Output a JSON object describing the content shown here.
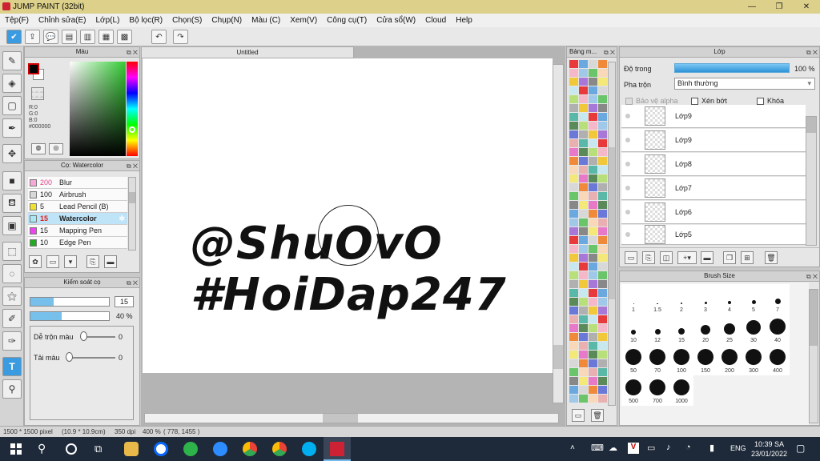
{
  "window": {
    "title": "JUMP PAINT (32bit)"
  },
  "menu": [
    "Tệp(F)",
    "Chỉnh sửa(E)",
    "Lớp(L)",
    "Bộ lọc(R)",
    "Chọn(S)",
    "Chụp(N)",
    "Màu (C)",
    "Xem(V)",
    "Công cụ(T)",
    "Cửa sổ(W)",
    "Cloud",
    "Help"
  ],
  "color_panel": {
    "title": "Màu",
    "r": "R:0",
    "g": "G:0",
    "b": "B:0",
    "hex": "#000000"
  },
  "brush_panel": {
    "title": "Cọ: Watercolor",
    "items": [
      {
        "size": "200",
        "name": "Blur",
        "color": "#f7a8d8",
        "size_color": "#e0458a"
      },
      {
        "size": "100",
        "name": "Airbrush",
        "color": "#d8d8d8",
        "size_color": "#222"
      },
      {
        "size": "5",
        "name": "Lead Pencil (B)",
        "color": "#f0e030",
        "size_color": "#222"
      },
      {
        "size": "15",
        "name": "Watercolor",
        "color": "#a8e8f0",
        "size_color": "#e02020"
      },
      {
        "size": "15",
        "name": "Mapping Pen",
        "color": "#ee44ee",
        "size_color": "#222"
      },
      {
        "size": "10",
        "name": "Edge Pen",
        "color": "#22aa22",
        "size_color": "#222"
      }
    ]
  },
  "control_panel": {
    "title": "Kiểm soát cọ",
    "size_value": "15",
    "opacity_value": "40 %",
    "opacity": 0.4,
    "blend_label": "Dễ trộn màu",
    "blend_value": "0",
    "redraw_label": "Tải màu",
    "redraw_value": "0"
  },
  "canvas": {
    "tab_title": "Untitled",
    "text_line1": "@ShuOvO",
    "text_line2": "#HoiDap247"
  },
  "palette_panel": {
    "title": "Bảng m..."
  },
  "layer_panel": {
    "title": "Lớp",
    "opacity_label": "Độ trong",
    "opacity_value": "100 %",
    "opacity": 1.0,
    "blend_label": "Pha trộn",
    "blend_value": "Bình thường",
    "protect_alpha": "Bảo vệ alpha",
    "clipping": "Xén bớt",
    "lock": "Khóa",
    "layers": [
      "Lớp9",
      "Lớp9",
      "Lớp8",
      "Lớp7",
      "Lớp6",
      "Lớp5"
    ]
  },
  "brush_size_panel": {
    "title": "Brush Size",
    "sizes": [
      "1",
      "1.5",
      "2",
      "3",
      "4",
      "5",
      "7",
      "10",
      "12",
      "15",
      "20",
      "25",
      "30",
      "40",
      "50",
      "70",
      "100",
      "150",
      "200",
      "300",
      "400",
      "500",
      "700",
      "1000"
    ]
  },
  "status": {
    "dimensions": "1500 * 1500 pixel",
    "cm": "(10.9 * 10.9cm)",
    "dpi": "350 dpi",
    "zoom": "400 %",
    "coords": "( 778, 1455 )"
  },
  "taskbar": {
    "lang": "ENG",
    "time": "10:39 SA",
    "date": "23/01/2022"
  }
}
